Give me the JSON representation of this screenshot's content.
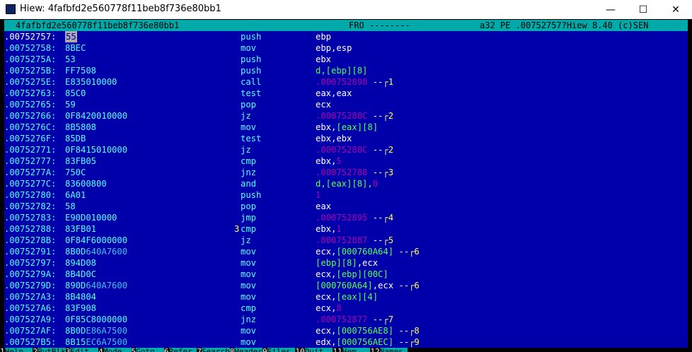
{
  "window": {
    "title": "Hiew: 4fafbfd2e560778f11beb8f736e80bb1",
    "minimize": "—",
    "maximize": "☐",
    "close": "✕"
  },
  "status": {
    "filename": "4fafbfd2e560778f11beb8f736e80bb1",
    "mode": "FRO --------",
    "info": "a32 PE .00752757?Hiew 8.40 (c)SEN"
  },
  "rows": [
    {
      "addr": ".00752757:",
      "hex": "55",
      "mn": "push",
      "ops": [
        [
          "w",
          "ebp"
        ]
      ],
      "sel": true,
      "cur": true
    },
    {
      "addr": ".00752758:",
      "hex": "8BEC",
      "mn": "mov",
      "ops": [
        [
          "w",
          "ebp,esp"
        ]
      ]
    },
    {
      "addr": ".0075275A:",
      "hex": "53",
      "mn": "push",
      "ops": [
        [
          "w",
          "ebx"
        ]
      ]
    },
    {
      "addr": ".0075275B:",
      "hex": "FF7508",
      "mn": "push",
      "ops": [
        [
          "g",
          "d,[ebp][8]"
        ]
      ]
    },
    {
      "addr": ".0075275E:",
      "hex": "E835010000",
      "mn": "call",
      "ops": [
        [
          "m",
          ".000752898"
        ],
        [
          "w",
          " --"
        ],
        [
          "y",
          "┌1"
        ]
      ]
    },
    {
      "addr": ".00752763:",
      "hex": "85C0",
      "mn": "test",
      "ops": [
        [
          "w",
          "eax,eax"
        ]
      ]
    },
    {
      "addr": ".00752765:",
      "hex": "59",
      "mn": "pop",
      "ops": [
        [
          "w",
          "ecx"
        ]
      ]
    },
    {
      "addr": ".00752766:",
      "hex": "0F8420010000",
      "mn": "jz",
      "ops": [
        [
          "m",
          ".00075288C"
        ],
        [
          "w",
          " --"
        ],
        [
          "y",
          "┌2"
        ]
      ]
    },
    {
      "addr": ".0075276C:",
      "hex": "8B5808",
      "mn": "mov",
      "ops": [
        [
          "w",
          "ebx,"
        ],
        [
          "g",
          "[eax][8]"
        ]
      ]
    },
    {
      "addr": ".0075276F:",
      "hex": "85DB",
      "mn": "test",
      "ops": [
        [
          "w",
          "ebx,ebx"
        ]
      ]
    },
    {
      "addr": ".00752771:",
      "hex": "0F8415010000",
      "mn": "jz",
      "ops": [
        [
          "m",
          ".00075288C"
        ],
        [
          "w",
          " --"
        ],
        [
          "y",
          "┌2"
        ]
      ]
    },
    {
      "addr": ".00752777:",
      "hex": "83FB05",
      "mn": "cmp",
      "ops": [
        [
          "w",
          "ebx,"
        ],
        [
          "m",
          "5"
        ]
      ]
    },
    {
      "addr": ".0075277A:",
      "hex": "750C",
      "mn": "jnz",
      "ops": [
        [
          "m",
          ".000752788"
        ],
        [
          "w",
          " --"
        ],
        [
          "y",
          "┌3"
        ]
      ]
    },
    {
      "addr": ".0075277C:",
      "hex": "83600800",
      "mn": "and",
      "ops": [
        [
          "g",
          "d,[eax][8],"
        ],
        [
          "m",
          "0"
        ]
      ]
    },
    {
      "addr": ".00752780:",
      "hex": "6A01",
      "mn": "push",
      "ops": [
        [
          "m",
          "1"
        ]
      ]
    },
    {
      "addr": ".00752782:",
      "hex": "58",
      "mn": "pop",
      "ops": [
        [
          "w",
          "eax"
        ]
      ]
    },
    {
      "addr": ".00752783:",
      "hex": "E90D010000",
      "mn": "jmp",
      "ops": [
        [
          "m",
          ".000752895"
        ],
        [
          "w",
          " --"
        ],
        [
          "y",
          "┌4"
        ]
      ]
    },
    {
      "addr": ".00752788:",
      "hex": "83FB01",
      "mn": "cmp",
      "mark": "3",
      "ops": [
        [
          "w",
          "ebx,"
        ],
        [
          "m",
          "1"
        ]
      ]
    },
    {
      "addr": ".0075278B:",
      "hex": "0F84F6000000",
      "mn": "jz",
      "ops": [
        [
          "m",
          ".000752887"
        ],
        [
          "w",
          " --"
        ],
        [
          "y",
          "┌5"
        ]
      ]
    },
    {
      "addr": ".00752791:",
      "hex": "8B0D",
      "hexhi": "640A7600",
      "mn": "mov",
      "ops": [
        [
          "w",
          "ecx,"
        ],
        [
          "g",
          "[000760A64]"
        ],
        [
          "w",
          " --"
        ],
        [
          "y",
          "┌6"
        ]
      ]
    },
    {
      "addr": ".00752797:",
      "hex": "894D08",
      "mn": "mov",
      "ops": [
        [
          "g",
          "[ebp][8]"
        ],
        [
          "w",
          ",ecx"
        ]
      ]
    },
    {
      "addr": ".0075279A:",
      "hex": "8B4D0C",
      "mn": "mov",
      "ops": [
        [
          "w",
          "ecx,"
        ],
        [
          "g",
          "[ebp][00C]"
        ]
      ]
    },
    {
      "addr": ".0075279D:",
      "hex": "890D",
      "hexhi": "640A7600",
      "mn": "mov",
      "ops": [
        [
          "g",
          "[000760A64]"
        ],
        [
          "w",
          ",ecx --"
        ],
        [
          "y",
          "┌6"
        ]
      ]
    },
    {
      "addr": ".007527A3:",
      "hex": "8B4804",
      "mn": "mov",
      "ops": [
        [
          "w",
          "ecx,"
        ],
        [
          "g",
          "[eax][4]"
        ]
      ]
    },
    {
      "addr": ".007527A6:",
      "hex": "83F908",
      "mn": "cmp",
      "ops": [
        [
          "w",
          "ecx,"
        ],
        [
          "m",
          "8"
        ]
      ]
    },
    {
      "addr": ".007527A9:",
      "hex": "0F85C8000000",
      "mn": "jnz",
      "ops": [
        [
          "m",
          ".000752877"
        ],
        [
          "w",
          " --"
        ],
        [
          "y",
          "┌7"
        ]
      ]
    },
    {
      "addr": ".007527AF:",
      "hex": "8B0D",
      "hexhi": "E86A7500",
      "mn": "mov",
      "ops": [
        [
          "w",
          "ecx,"
        ],
        [
          "g",
          "[000756AE8]"
        ],
        [
          "w",
          " --"
        ],
        [
          "y",
          "┌8"
        ]
      ]
    },
    {
      "addr": ".007527B5:",
      "hex": "8B15",
      "hexhi": "EC6A7500",
      "mn": "mov",
      "ops": [
        [
          "w",
          "edx,"
        ],
        [
          "g",
          "[000756AEC]"
        ],
        [
          "w",
          " --"
        ],
        [
          "y",
          "┌9"
        ]
      ]
    }
  ],
  "fkeys": [
    {
      "n": "1",
      "l": "Help"
    },
    {
      "n": "2",
      "l": "PutBlk"
    },
    {
      "n": "3",
      "l": "Edit"
    },
    {
      "n": "4",
      "l": "Mode"
    },
    {
      "n": "5",
      "l": "Goto"
    },
    {
      "n": "6",
      "l": "Refer"
    },
    {
      "n": "7",
      "l": "Search"
    },
    {
      "n": "8",
      "l": "Header"
    },
    {
      "n": "9",
      "l": "Files"
    },
    {
      "n": "10",
      "l": "Quit"
    },
    {
      "n": "11",
      "l": "Hem"
    },
    {
      "n": "12",
      "l": "Names"
    }
  ],
  "colors": {
    "code_bg": "#0000aa",
    "status_bg": "#00aaaa",
    "address": "#55ffff",
    "mnemonic": "#55ffff",
    "register": "#ffffff",
    "memory": "#55ff55",
    "immediate": "#aa00aa",
    "jump_mark": "#ffff55"
  }
}
